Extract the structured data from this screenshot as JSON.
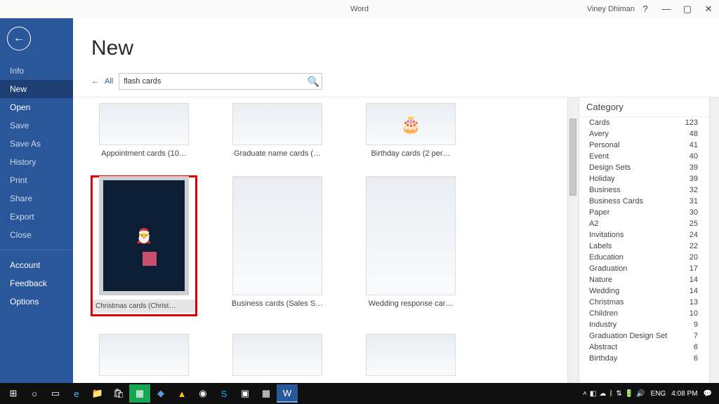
{
  "titlebar": {
    "app": "Word",
    "user": "Viney Dhiman"
  },
  "sidebar": {
    "items": [
      {
        "label": "Info",
        "enabled": false
      },
      {
        "label": "New",
        "enabled": true,
        "selected": true
      },
      {
        "label": "Open",
        "enabled": true
      },
      {
        "label": "Save",
        "enabled": false
      },
      {
        "label": "Save As",
        "enabled": false
      },
      {
        "label": "History",
        "enabled": false
      },
      {
        "label": "Print",
        "enabled": false
      },
      {
        "label": "Share",
        "enabled": false
      },
      {
        "label": "Export",
        "enabled": false
      },
      {
        "label": "Close",
        "enabled": false
      }
    ],
    "footer": [
      {
        "label": "Account"
      },
      {
        "label": "Feedback"
      },
      {
        "label": "Options"
      }
    ]
  },
  "page": {
    "heading": "New",
    "back_label": "All",
    "search_value": "flash cards"
  },
  "templates_row1": [
    {
      "label": "Appointment cards (10…"
    },
    {
      "label": "Graduate name cards (…"
    },
    {
      "label": "Birthday cards (2 per…"
    }
  ],
  "templates_row2": [
    {
      "label": "Christmas cards (Christ…",
      "selected": true
    },
    {
      "label": "Business cards (Sales S…"
    },
    {
      "label": "Wedding response car…"
    }
  ],
  "categories_header": "Category",
  "categories": [
    {
      "name": "Cards",
      "count": 123
    },
    {
      "name": "Avery",
      "count": 48
    },
    {
      "name": "Personal",
      "count": 41
    },
    {
      "name": "Event",
      "count": 40
    },
    {
      "name": "Design Sets",
      "count": 39
    },
    {
      "name": "Holiday",
      "count": 39
    },
    {
      "name": "Business",
      "count": 32
    },
    {
      "name": "Business Cards",
      "count": 31
    },
    {
      "name": "Paper",
      "count": 30,
      "selected": true
    },
    {
      "name": "A2",
      "count": 25
    },
    {
      "name": "Invitations",
      "count": 24
    },
    {
      "name": "Labels",
      "count": 22
    },
    {
      "name": "Education",
      "count": 20
    },
    {
      "name": "Graduation",
      "count": 17
    },
    {
      "name": "Nature",
      "count": 14
    },
    {
      "name": "Wedding",
      "count": 14
    },
    {
      "name": "Christmas",
      "count": 13
    },
    {
      "name": "Children",
      "count": 10
    },
    {
      "name": "Industry",
      "count": 9
    },
    {
      "name": "Graduation Design Set",
      "count": 7
    },
    {
      "name": "Abstract",
      "count": 6
    },
    {
      "name": "Birthday",
      "count": 6
    }
  ],
  "systray": {
    "lang": "ENG",
    "time": "4:08 PM"
  }
}
